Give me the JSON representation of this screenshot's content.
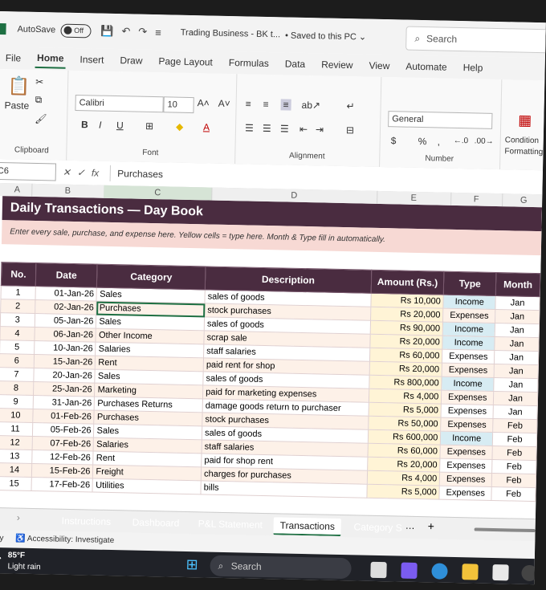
{
  "titlebar": {
    "autosave_label": "AutoSave",
    "autosave_state": "Off",
    "doc_title": "Trading Business - BK t...",
    "save_status": "• Saved to this PC ⌄",
    "search_placeholder": "Search"
  },
  "menu": [
    "File",
    "Home",
    "Insert",
    "Draw",
    "Page Layout",
    "Formulas",
    "Data",
    "Review",
    "View",
    "Automate",
    "Help"
  ],
  "ribbon": {
    "paste_label": "Paste",
    "clipboard_label": "Clipboard",
    "font_name": "Calibri",
    "font_size": "10",
    "font_label": "Font",
    "alignment_label": "Alignment",
    "number_format": "General",
    "number_label": "Number",
    "conditional_label_1": "Condition",
    "conditional_label_2": "Formatting"
  },
  "formula_bar": {
    "name_box": "C6",
    "value": "Purchases"
  },
  "columns": [
    "A",
    "B",
    "C",
    "D",
    "E",
    "F",
    "G"
  ],
  "sheet": {
    "title": "Daily Transactions — Day Book",
    "subtitle": "Enter every sale, purchase, and expense here. Yellow cells = type here. Month & Type fill in automatically.",
    "headers": [
      "No.",
      "Date",
      "Category",
      "Description",
      "Amount (Rs.)",
      "Type",
      "Month"
    ],
    "rows": [
      [
        "1",
        "01-Jan-26",
        "Sales",
        "sales of goods",
        "Rs 10,000",
        "Income",
        "Jan"
      ],
      [
        "2",
        "02-Jan-26",
        "Purchases",
        "stock purchases",
        "Rs 20,000",
        "Expenses",
        "Jan"
      ],
      [
        "3",
        "05-Jan-26",
        "Sales",
        "sales of goods",
        "Rs 90,000",
        "Income",
        "Jan"
      ],
      [
        "4",
        "06-Jan-26",
        "Other Income",
        "scrap sale",
        "Rs 20,000",
        "Income",
        "Jan"
      ],
      [
        "5",
        "10-Jan-26",
        "Salaries",
        "staff salaries",
        "Rs 60,000",
        "Expenses",
        "Jan"
      ],
      [
        "6",
        "15-Jan-26",
        "Rent",
        "paid rent for shop",
        "Rs 20,000",
        "Expenses",
        "Jan"
      ],
      [
        "7",
        "20-Jan-26",
        "Sales",
        "sales of goods",
        "Rs 800,000",
        "Income",
        "Jan"
      ],
      [
        "8",
        "25-Jan-26",
        "Marketing",
        "paid for marketing expenses",
        "Rs 4,000",
        "Expenses",
        "Jan"
      ],
      [
        "9",
        "31-Jan-26",
        "Purchases Returns",
        "damage goods  return to purchaser",
        "Rs 5,000",
        "Expenses",
        "Jan"
      ],
      [
        "10",
        "01-Feb-26",
        "Purchases",
        "stock purchases",
        "Rs 50,000",
        "Expenses",
        "Feb"
      ],
      [
        "11",
        "05-Feb-26",
        "Sales",
        "sales of goods",
        "Rs 600,000",
        "Income",
        "Feb"
      ],
      [
        "12",
        "07-Feb-26",
        "Salaries",
        "staff salaries",
        "Rs 60,000",
        "Expenses",
        "Feb"
      ],
      [
        "13",
        "12-Feb-26",
        "Rent",
        "paid for shop rent",
        "Rs 20,000",
        "Expenses",
        "Feb"
      ],
      [
        "14",
        "15-Feb-26",
        "Freight",
        "charges for purchases",
        "Rs 4,000",
        "Expenses",
        "Feb"
      ],
      [
        "15",
        "17-Feb-26",
        "Utilities",
        "bills",
        "Rs 5,000",
        "Expenses",
        "Feb"
      ]
    ]
  },
  "tabs": [
    {
      "label": "Instructions",
      "color": "#5b9bd5"
    },
    {
      "label": "Dashboard",
      "color": "#4472c4"
    },
    {
      "label": "P&L Statement",
      "color": "#d9534f"
    },
    {
      "label": "Transactions",
      "color": "#ffffff"
    },
    {
      "label": "Category S",
      "color": "#5b8def"
    }
  ],
  "status": {
    "ready": "ady",
    "accessibility": "Accessibility: Investigate"
  },
  "taskbar": {
    "temperature": "85°F",
    "weather": "Light rain",
    "search_placeholder": "Search"
  }
}
